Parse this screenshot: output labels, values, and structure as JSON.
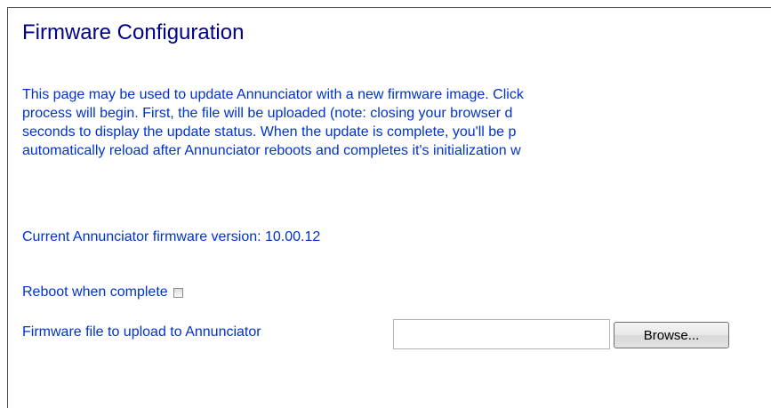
{
  "page": {
    "title": "Firmware Configuration"
  },
  "description": {
    "lines": [
      "This page may be used to update Annunciator with a new firmware image. Click",
      "process will begin. First, the file will be uploaded (note: closing your browser d",
      "seconds to display the update status. When the update is complete, you'll be p",
      "automatically reload after Annunciator reboots and completes it's initialization w"
    ]
  },
  "firmware": {
    "version_text": "Current Annunciator firmware version: 10.00.12"
  },
  "form": {
    "reboot_label": "Reboot when complete",
    "reboot_checked": false,
    "file_label": "Firmware file to upload to Annunciator",
    "file_value": "",
    "browse_label": "Browse..."
  },
  "colors": {
    "title": "#000088",
    "text": "#0033cc"
  }
}
